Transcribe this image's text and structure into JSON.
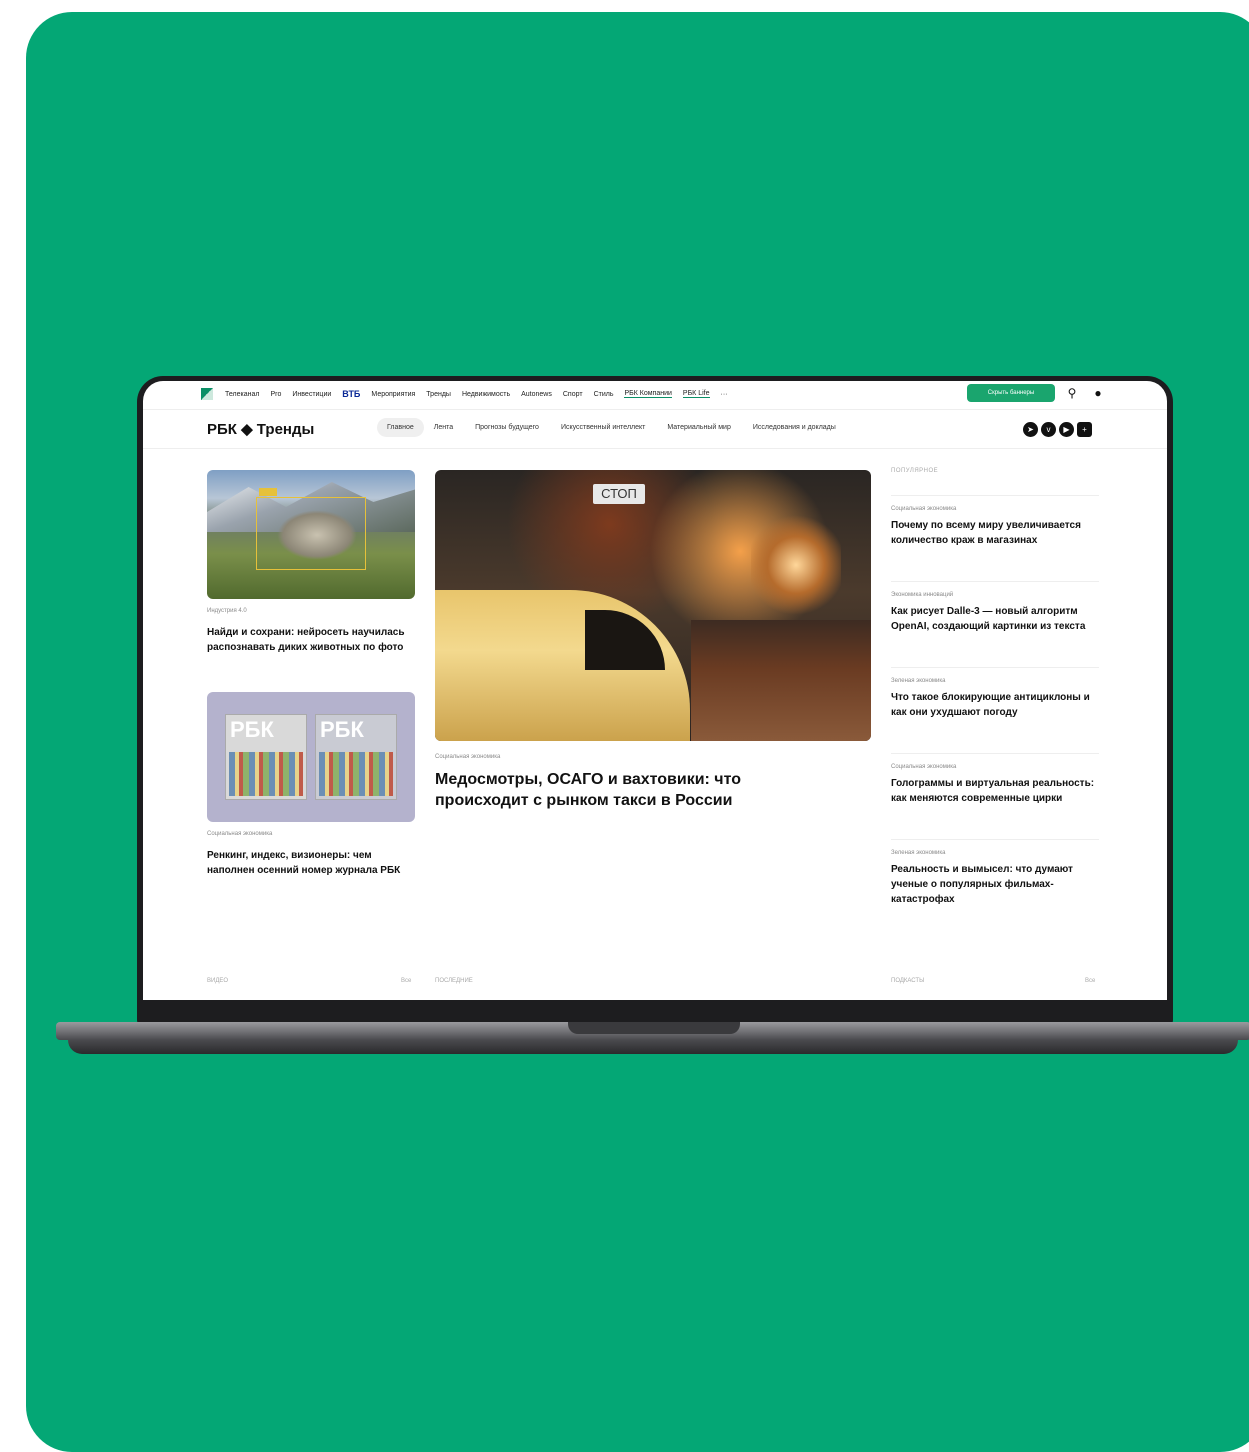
{
  "colors": {
    "background_accent": "#04a775",
    "brand_green": "#1aa56e"
  },
  "topbar": {
    "items": [
      "Телеканал",
      "Pro",
      "Инвестиции",
      "ВТБ",
      "Мероприятия",
      "Тренды",
      "Недвижимость",
      "Autonews",
      "Спорт",
      "Стиль",
      "РБК Компании",
      "РБК Life",
      "···"
    ],
    "hide_banners_label": "Скрыть баннеры",
    "icons": [
      "search-icon",
      "user-icon"
    ]
  },
  "header": {
    "brand": "РБК ◆ Тренды",
    "sections": [
      "Главное",
      "Лента",
      "Прогнозы будущего",
      "Искусственный интеллект",
      "Материальный мир",
      "Исследования и доклады"
    ],
    "social_icons": [
      "telegram-icon",
      "vk-icon",
      "youtube-icon",
      "rss-icon"
    ]
  },
  "left_articles": [
    {
      "kicker": "Индустрия 4.0",
      "title": "Найди и сохрани: нейросеть научилась распознавать диких животных по фото"
    },
    {
      "kicker": "Социальная экономика",
      "title": "Ренкинг, индекс, визионеры: чем наполнен осенний номер журнала РБК"
    }
  ],
  "rbk_logo_text": "РБК",
  "lead": {
    "kicker": "Социальная экономика",
    "title": "Медосмотры, ОСАГО и вахтовики: что происходит с рынком такси в России",
    "sign_text": "СТОП"
  },
  "popular": {
    "label": "ПОПУЛЯРНОЕ",
    "items": [
      {
        "kicker": "Социальная экономика",
        "title": "Почему по всему миру увеличивается количество краж в магазинах"
      },
      {
        "kicker": "Экономика инноваций",
        "title": "Как рисует Dalle-3 — новый алгоритм OpenAI, создающий картинки из текста"
      },
      {
        "kicker": "Зеленая экономика",
        "title": "Что такое блокирующие антициклоны и как они ухудшают погоду"
      },
      {
        "kicker": "Социальная экономика",
        "title": "Голограммы и виртуальная реальность: как меняются современные цирки"
      },
      {
        "kicker": "Зеленая экономика",
        "title": "Реальность и вымысел: что думают ученые о популярных фильмах-катастрофах"
      }
    ]
  },
  "footer": {
    "video": "ВИДЕО",
    "video_all": "Все",
    "latest": "ПОСЛЕДНИЕ",
    "podcasts": "ПОДКАСТЫ",
    "podcasts_all": "Все"
  }
}
